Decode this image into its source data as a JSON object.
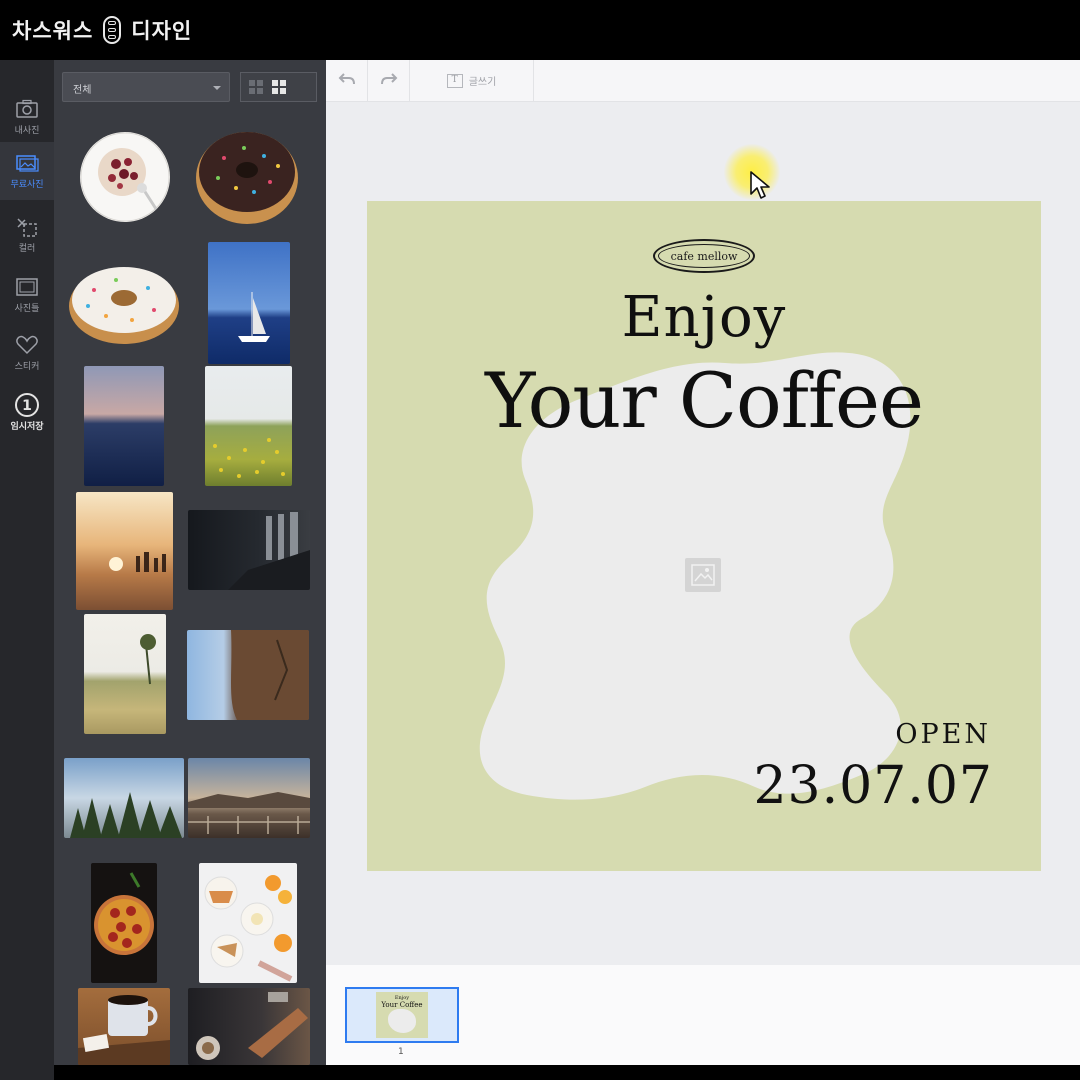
{
  "app": {
    "title_part1": "차스워스",
    "title_part2": "디자인"
  },
  "rail": {
    "items": [
      {
        "label": "내사진",
        "icon": "camera-icon"
      },
      {
        "label": "무료사진",
        "icon": "images-icon"
      },
      {
        "label": "컬러",
        "icon": "cut-icon"
      },
      {
        "label": "사진틀",
        "icon": "frame-icon"
      },
      {
        "label": "스티커",
        "icon": "heart-icon"
      },
      {
        "label": "임시저장",
        "icon": "number-one-icon"
      }
    ],
    "active_index": 1
  },
  "panel": {
    "category_select": "전체",
    "view_modes": [
      "list",
      "grid"
    ],
    "active_view": "grid"
  },
  "toolbar": {
    "undo_icon": "undo-icon",
    "redo_icon": "redo-icon",
    "text_label": "글쓰기"
  },
  "design": {
    "badge": "cafe mellow",
    "headline_small": "Enjoy",
    "headline_large": "Your Coffee",
    "open_label": "OPEN",
    "open_date": "23.07.07",
    "background_color": "#d6dbb0",
    "blob_color": "#ececec"
  },
  "pages": {
    "items": [
      {
        "number": "1"
      }
    ],
    "selected": 0
  }
}
